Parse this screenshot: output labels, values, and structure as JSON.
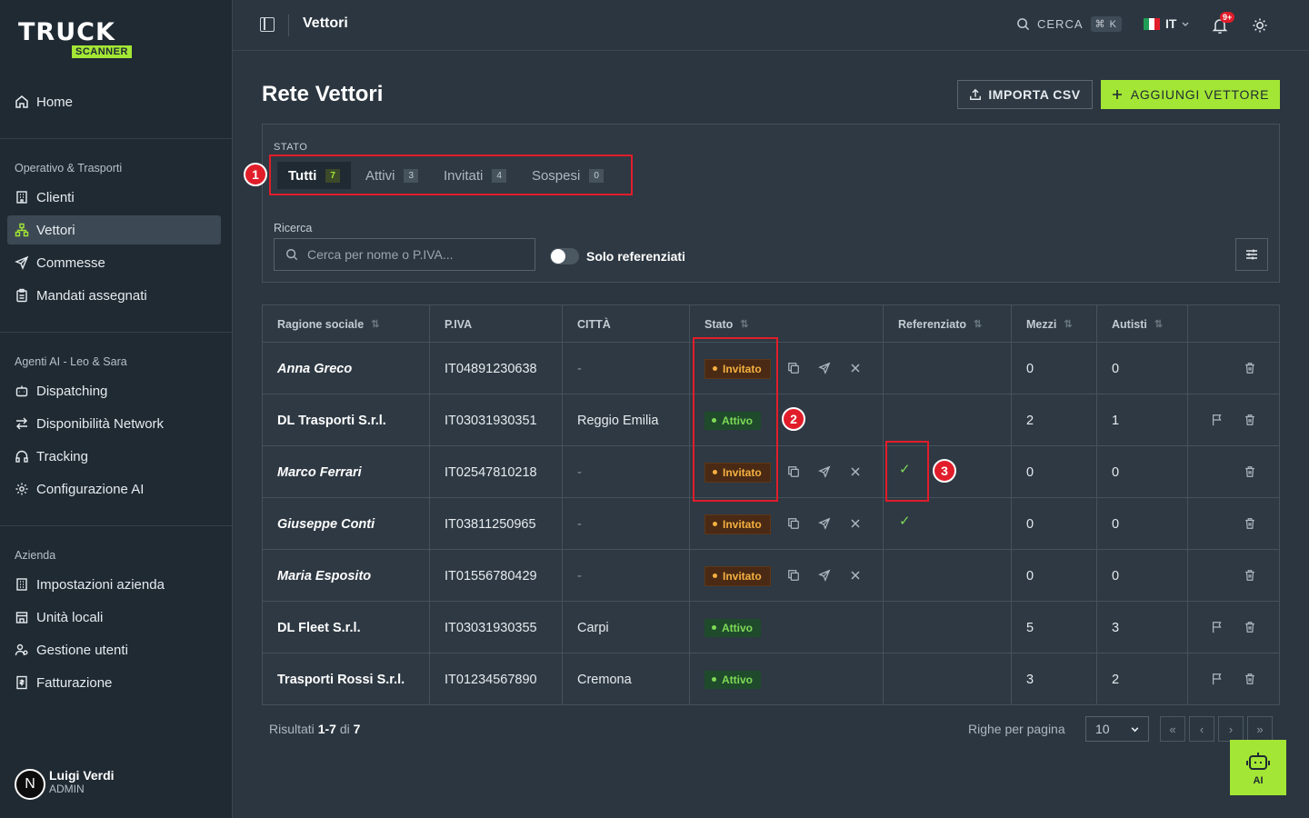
{
  "brand": {
    "logo_main": "TRUCK",
    "logo_sub": "SCANNER",
    "accent": "#a3e635"
  },
  "sidebar": {
    "home": "Home",
    "sections": [
      {
        "label": "Operativo & Trasporti",
        "items": [
          "Clienti",
          "Vettori",
          "Commesse",
          "Mandati assegnati"
        ]
      },
      {
        "label": "Agenti AI - Leo & Sara",
        "items": [
          "Dispatching",
          "Disponibilità Network",
          "Tracking",
          "Configurazione AI"
        ]
      },
      {
        "label": "Azienda",
        "items": [
          "Impostazioni azienda",
          "Unità locali",
          "Gestione utenti",
          "Fatturazione"
        ]
      }
    ],
    "active": "Vettori",
    "user": {
      "initial": "N",
      "name": "Luigi Verdi",
      "role": "ADMIN"
    }
  },
  "topbar": {
    "title": "Vettori",
    "search_label": "CERCA",
    "search_kbd": "⌘ K",
    "lang": "IT",
    "notif_badge": "9+"
  },
  "page": {
    "title": "Rete Vettori",
    "import_label": "IMPORTA CSV",
    "add_label": "AGGIUNGI VETTORE"
  },
  "filters": {
    "stato_label": "STATO",
    "tabs": [
      {
        "label": "Tutti",
        "count": "7"
      },
      {
        "label": "Attivi",
        "count": "3"
      },
      {
        "label": "Invitati",
        "count": "4"
      },
      {
        "label": "Sospesi",
        "count": "0"
      }
    ],
    "ricerca_label": "Ricerca",
    "search_placeholder": "Cerca per nome o P.IVA...",
    "toggle_label": "Solo referenziati"
  },
  "table": {
    "columns": [
      "Ragione sociale",
      "P.IVA",
      "CITTÀ",
      "Stato",
      "Referenziato",
      "Mezzi",
      "Autisti"
    ],
    "rows": [
      {
        "name": "Anna Greco",
        "piva": "IT04891230638",
        "citta": "-",
        "stato": "Invitato",
        "ref": false,
        "mezzi": "0",
        "autisti": "0"
      },
      {
        "name": "DL Trasporti S.r.l.",
        "piva": "IT03031930351",
        "citta": "Reggio Emilia",
        "stato": "Attivo",
        "ref": false,
        "mezzi": "2",
        "autisti": "1"
      },
      {
        "name": "Marco Ferrari",
        "piva": "IT02547810218",
        "citta": "-",
        "stato": "Invitato",
        "ref": true,
        "mezzi": "0",
        "autisti": "0"
      },
      {
        "name": "Giuseppe Conti",
        "piva": "IT03811250965",
        "citta": "-",
        "stato": "Invitato",
        "ref": true,
        "mezzi": "0",
        "autisti": "0"
      },
      {
        "name": "Maria Esposito",
        "piva": "IT01556780429",
        "citta": "-",
        "stato": "Invitato",
        "ref": false,
        "mezzi": "0",
        "autisti": "0"
      },
      {
        "name": "DL Fleet S.r.l.",
        "piva": "IT03031930355",
        "citta": "Carpi",
        "stato": "Attivo",
        "ref": false,
        "mezzi": "5",
        "autisti": "3"
      },
      {
        "name": "Trasporti Rossi S.r.l.",
        "piva": "IT01234567890",
        "citta": "Cremona",
        "stato": "Attivo",
        "ref": false,
        "mezzi": "3",
        "autisti": "2"
      }
    ]
  },
  "footer": {
    "results_prefix": "Risultati",
    "results_range": "1-7",
    "results_of": "di",
    "results_total": "7",
    "rpp_label": "Righe per pagina",
    "rpp_value": "10"
  },
  "ai_button": "AI",
  "annotations": [
    "1",
    "2",
    "3"
  ]
}
